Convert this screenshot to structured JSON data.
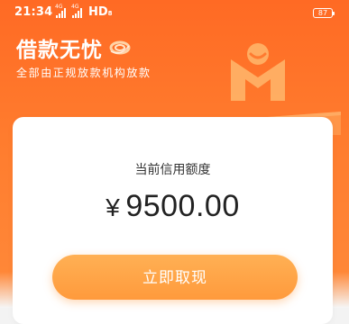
{
  "status_bar": {
    "time": "21:34",
    "signal_tag_1": "4G",
    "signal_tag_2": "4G",
    "network": "HD",
    "network_sub": "8",
    "battery": "87"
  },
  "hero": {
    "title": "借款无忧",
    "subtitle": "全部由正规放款机构放款"
  },
  "card": {
    "label": "当前信用额度",
    "currency": "¥",
    "amount": "9500.00",
    "button": "立即取现"
  },
  "colors": {
    "brand_orange": "#ff6a24",
    "button_orange": "#ffa548",
    "text_dark": "#222222"
  },
  "icons": [
    "swirl-icon",
    "brand-logo-icon",
    "battery-icon",
    "signal-icon"
  ]
}
